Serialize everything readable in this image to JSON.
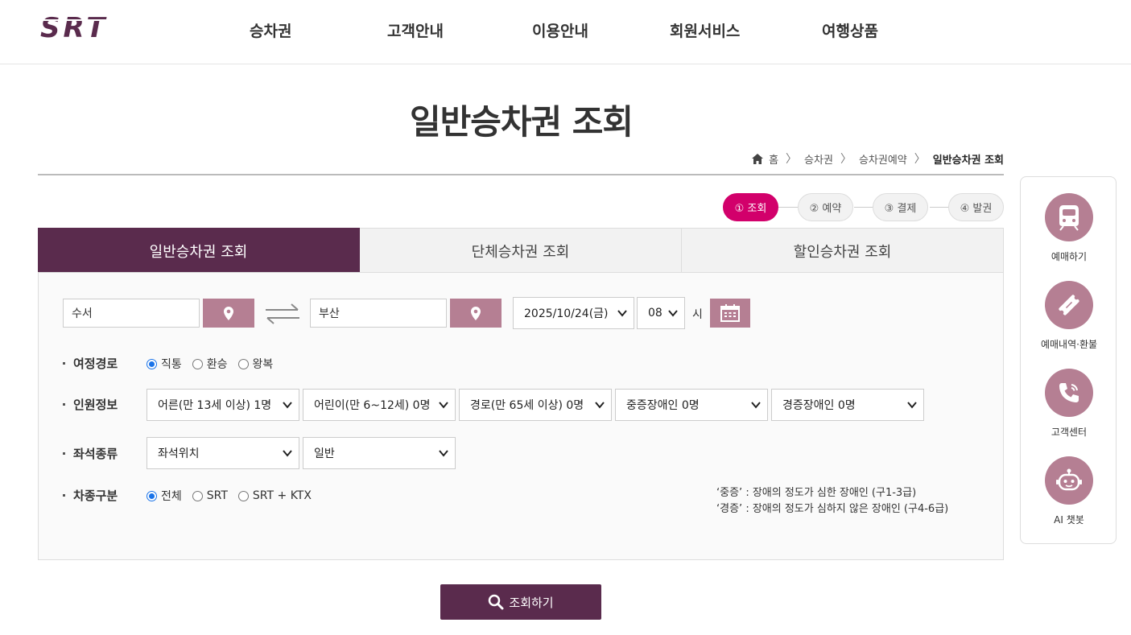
{
  "header": {
    "logo_text": "SRT",
    "nav": [
      "승차권",
      "고객안내",
      "이용안내",
      "회원서비스",
      "여행상품"
    ]
  },
  "page": {
    "title": "일반승차권 조회",
    "breadcrumb": [
      "홈",
      "승차권",
      "승차권예약",
      "일반승차권 조회"
    ]
  },
  "steps": [
    "① 조회",
    "② 예약",
    "③ 결제",
    "④ 발권"
  ],
  "tabs": [
    "일반승차권 조회",
    "단체승차권 조회",
    "할인승차권 조회"
  ],
  "search": {
    "departure": "수서",
    "arrival": "부산",
    "date": "2025/10/24(금)",
    "hour": "08",
    "hour_unit": "시"
  },
  "route": {
    "label": "여정경로",
    "options": [
      "직통",
      "환승",
      "왕복"
    ],
    "selected": "직통"
  },
  "passengers": {
    "label": "인원정보",
    "selects": [
      "어른(만 13세 이상) 1명",
      "어린이(만 6~12세) 0명",
      "경로(만 65세 이상) 0명",
      "중증장애인 0명",
      "경증장애인 0명"
    ]
  },
  "seat": {
    "label": "좌석종류",
    "selects": [
      "좌석위치",
      "일반"
    ]
  },
  "train_type": {
    "label": "차종구분",
    "options": [
      "전체",
      "SRT",
      "SRT + KTX"
    ],
    "selected": "전체"
  },
  "notes": [
    "‘중증’ : 장애의 정도가 심한 장애인 (구1-3급)",
    "‘경증’ : 장애의 정도가 심하지 않은 장애인 (구4-6급)"
  ],
  "search_button": "조회하기",
  "quick_menu": [
    "예매하기",
    "예매내역·환불",
    "고객센터",
    "AI 챗봇"
  ],
  "colors": {
    "brand": "#5a2b4d",
    "accent": "#b57f93",
    "active_step": "#d2006b"
  }
}
